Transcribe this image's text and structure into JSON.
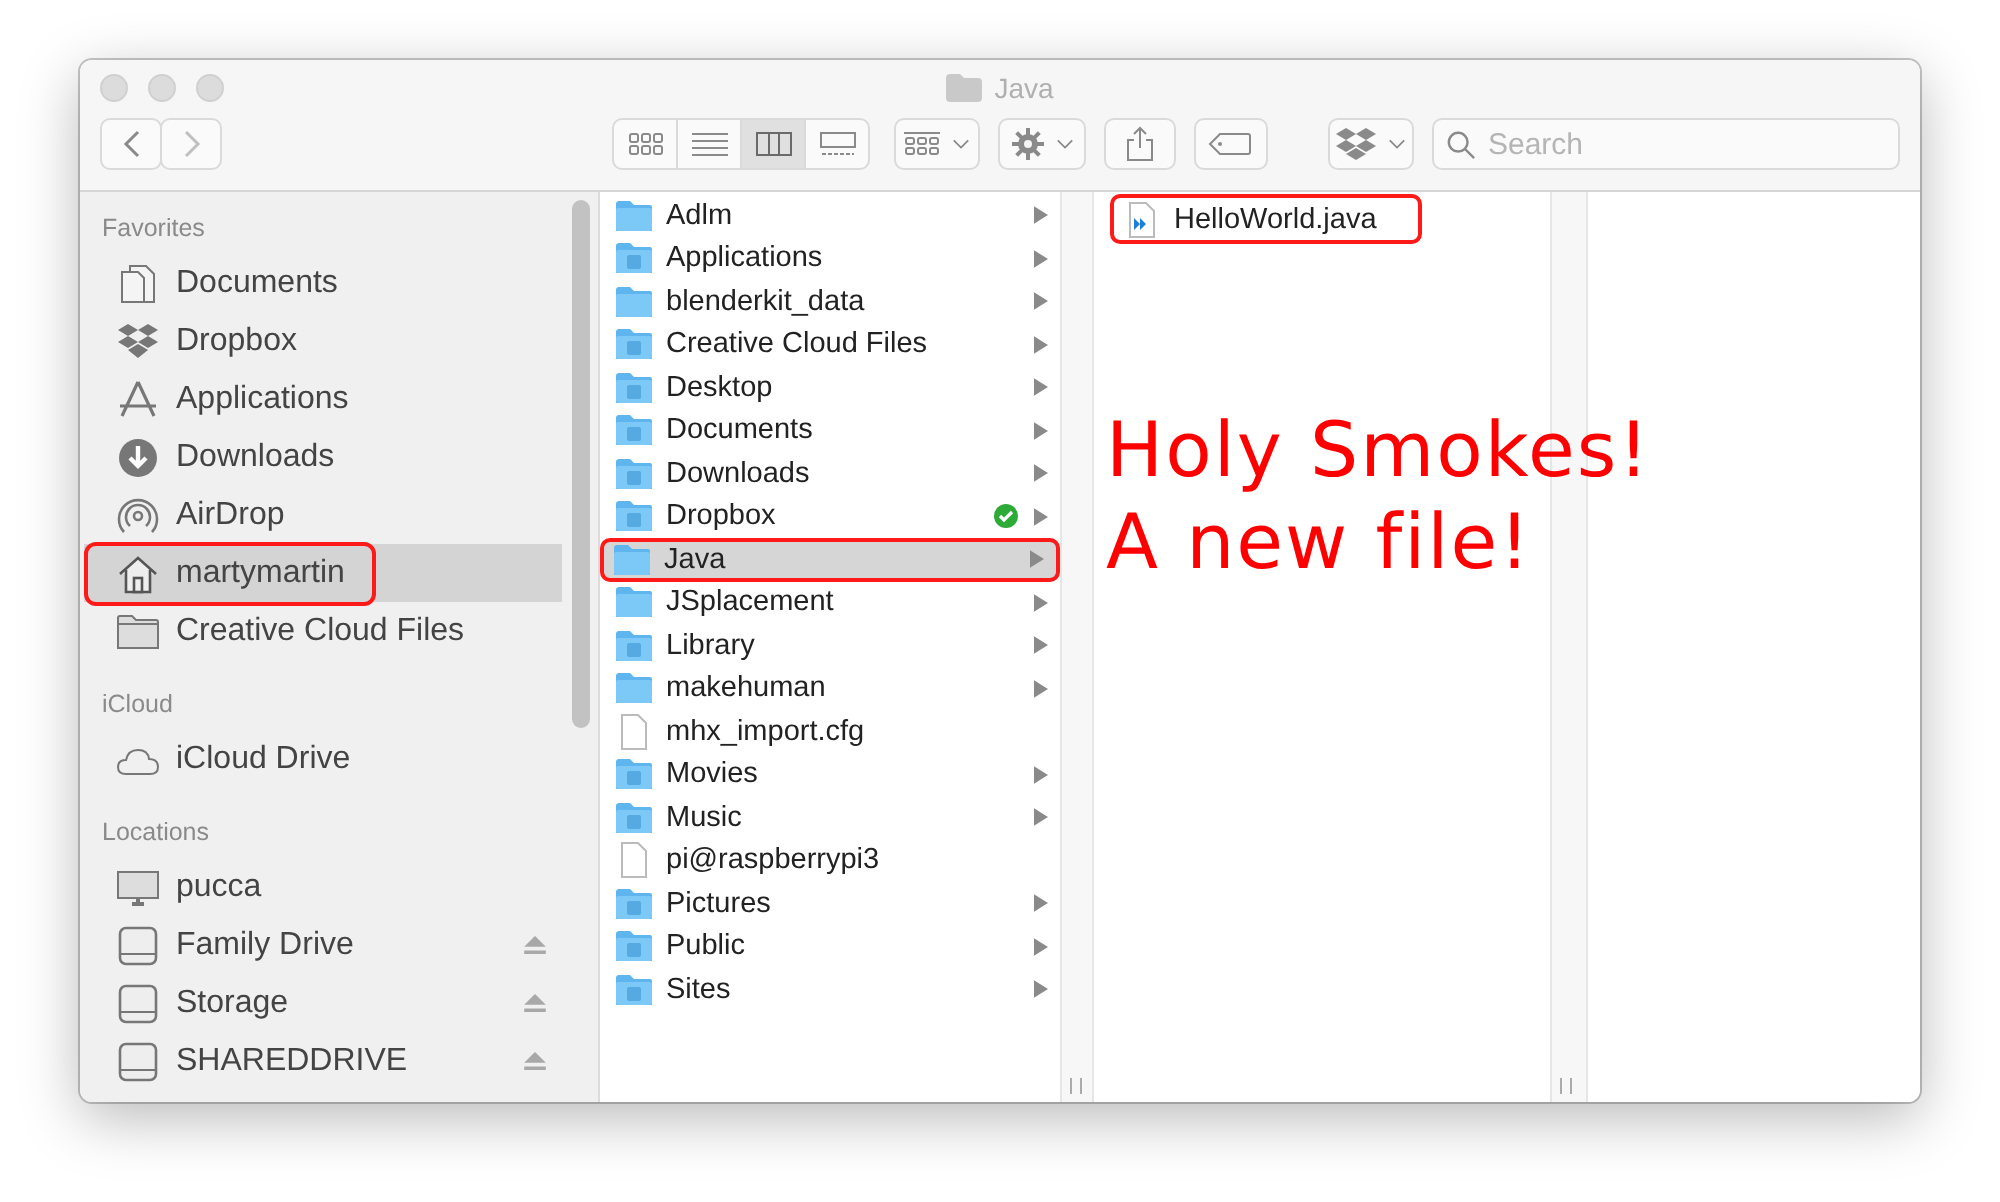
{
  "window": {
    "title": "Java"
  },
  "toolbar": {
    "views": [
      {
        "kind": "icons",
        "selected": false
      },
      {
        "kind": "list",
        "selected": false
      },
      {
        "kind": "columns",
        "selected": true
      },
      {
        "kind": "gallery",
        "selected": false
      }
    ],
    "search": {
      "placeholder": "Search"
    }
  },
  "sidebar": {
    "sections": [
      {
        "title": "Favorites",
        "items": [
          {
            "label": "Documents",
            "kind": "documents",
            "selected": false,
            "annotated": false,
            "ejectable": false
          },
          {
            "label": "Dropbox",
            "kind": "dropbox",
            "selected": false,
            "annotated": false,
            "ejectable": false
          },
          {
            "label": "Applications",
            "kind": "applications",
            "selected": false,
            "annotated": false,
            "ejectable": false
          },
          {
            "label": "Downloads",
            "kind": "downloads",
            "selected": false,
            "annotated": false,
            "ejectable": false
          },
          {
            "label": "AirDrop",
            "kind": "airdrop",
            "selected": false,
            "annotated": false,
            "ejectable": false
          },
          {
            "label": "martymartin",
            "kind": "home",
            "selected": true,
            "annotated": true,
            "ejectable": false
          },
          {
            "label": "Creative Cloud Files",
            "kind": "folder",
            "selected": false,
            "annotated": false,
            "ejectable": false
          }
        ]
      },
      {
        "title": "iCloud",
        "items": [
          {
            "label": "iCloud Drive",
            "kind": "cloud",
            "selected": false,
            "annotated": false,
            "ejectable": false
          }
        ]
      },
      {
        "title": "Locations",
        "items": [
          {
            "label": "pucca",
            "kind": "computer",
            "selected": false,
            "annotated": false,
            "ejectable": false
          },
          {
            "label": "Family Drive",
            "kind": "drive",
            "selected": false,
            "annotated": false,
            "ejectable": true
          },
          {
            "label": "Storage",
            "kind": "drive",
            "selected": false,
            "annotated": false,
            "ejectable": true
          },
          {
            "label": "SHAREDDRIVE",
            "kind": "drive",
            "selected": false,
            "annotated": false,
            "ejectable": true
          }
        ]
      }
    ]
  },
  "columns": [
    {
      "items": [
        {
          "name": "Adlm",
          "kind": "folder",
          "selected": false,
          "annotated": false,
          "synced": false
        },
        {
          "name": "Applications",
          "kind": "apps-folder",
          "selected": false,
          "annotated": false,
          "synced": false
        },
        {
          "name": "blenderkit_data",
          "kind": "folder",
          "selected": false,
          "annotated": false,
          "synced": false
        },
        {
          "name": "Creative Cloud Files",
          "kind": "cloud-folder",
          "selected": false,
          "annotated": false,
          "synced": false
        },
        {
          "name": "Desktop",
          "kind": "desktop-folder",
          "selected": false,
          "annotated": false,
          "synced": false
        },
        {
          "name": "Documents",
          "kind": "documents-folder",
          "selected": false,
          "annotated": false,
          "synced": false
        },
        {
          "name": "Downloads",
          "kind": "downloads-folder",
          "selected": false,
          "annotated": false,
          "synced": false
        },
        {
          "name": "Dropbox",
          "kind": "dropbox-folder",
          "selected": false,
          "annotated": false,
          "synced": true
        },
        {
          "name": "Java",
          "kind": "folder",
          "selected": true,
          "annotated": true,
          "synced": false
        },
        {
          "name": "JSplacement",
          "kind": "folder",
          "selected": false,
          "annotated": false,
          "synced": false
        },
        {
          "name": "Library",
          "kind": "library-folder",
          "selected": false,
          "annotated": false,
          "synced": false
        },
        {
          "name": "makehuman",
          "kind": "folder",
          "selected": false,
          "annotated": false,
          "synced": false
        },
        {
          "name": "mhx_import.cfg",
          "kind": "file",
          "selected": false,
          "annotated": false,
          "synced": false
        },
        {
          "name": "Movies",
          "kind": "movies-folder",
          "selected": false,
          "annotated": false,
          "synced": false
        },
        {
          "name": "Music",
          "kind": "music-folder",
          "selected": false,
          "annotated": false,
          "synced": false
        },
        {
          "name": "pi@raspberrypi3",
          "kind": "file",
          "selected": false,
          "annotated": false,
          "synced": false
        },
        {
          "name": "Pictures",
          "kind": "pictures-folder",
          "selected": false,
          "annotated": false,
          "synced": false
        },
        {
          "name": "Public",
          "kind": "public-folder",
          "selected": false,
          "annotated": false,
          "synced": false
        },
        {
          "name": "Sites",
          "kind": "sites-folder",
          "selected": false,
          "annotated": false,
          "synced": false
        }
      ]
    },
    {
      "items": [
        {
          "name": "HelloWorld.java",
          "kind": "code-file",
          "selected": false,
          "annotated": true,
          "synced": false
        }
      ]
    },
    {}
  ],
  "annotation": {
    "lines": [
      "Holy Smokes!",
      "A new file!"
    ]
  }
}
